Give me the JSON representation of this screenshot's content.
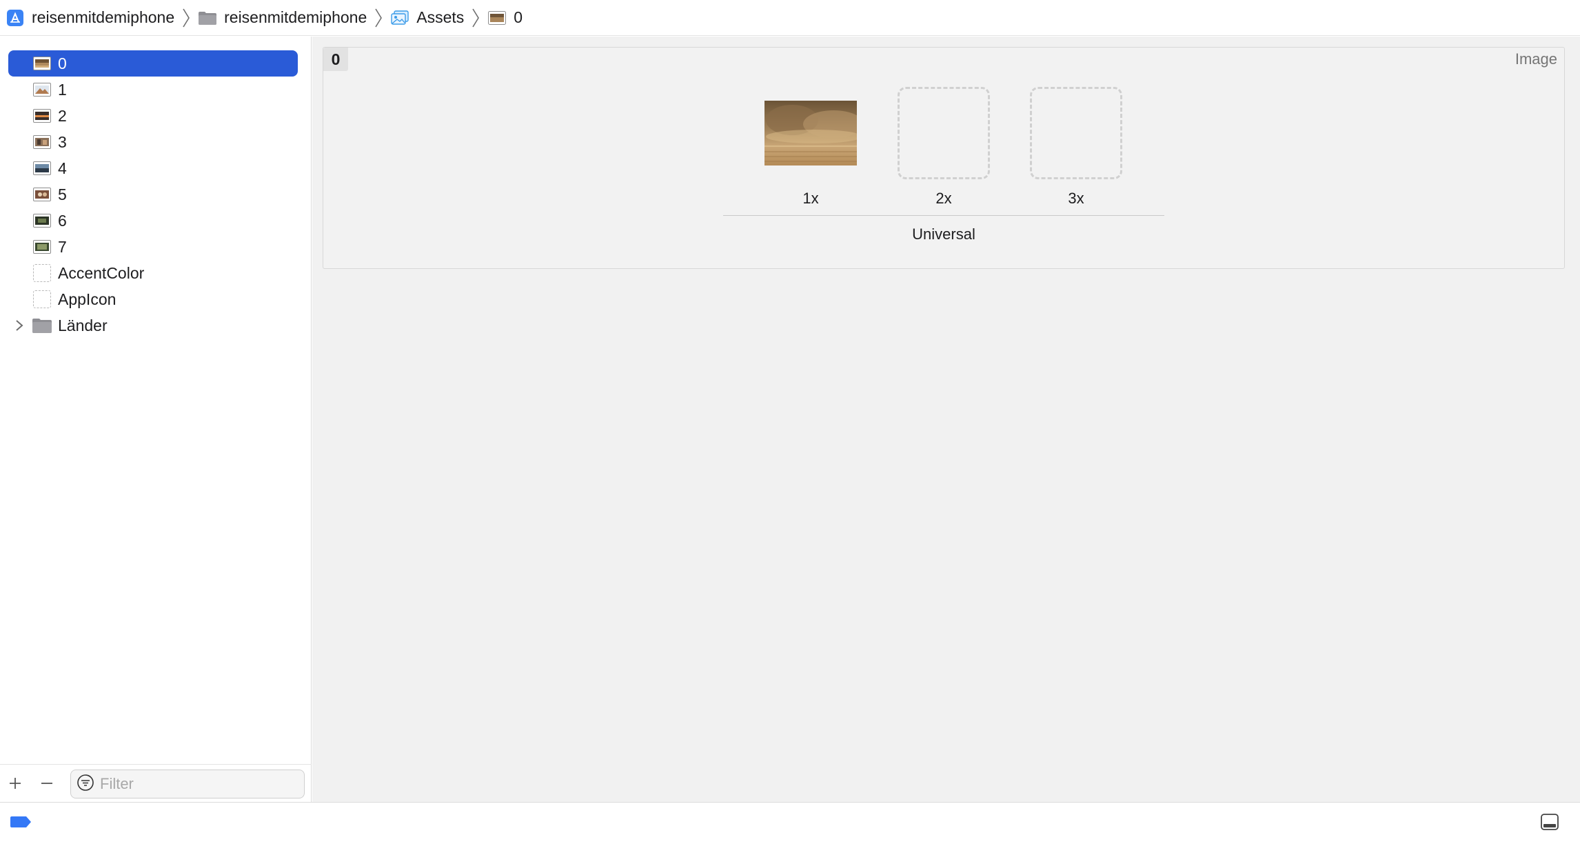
{
  "breadcrumb": {
    "items": [
      {
        "label": "reisenmitdemiphone",
        "icon": "xcode-project-icon"
      },
      {
        "label": "reisenmitdemiphone",
        "icon": "folder-icon"
      },
      {
        "label": "Assets",
        "icon": "asset-catalog-icon"
      },
      {
        "label": "0",
        "icon": "image-set-icon"
      }
    ]
  },
  "sidebar": {
    "items": [
      {
        "label": "0",
        "kind": "image",
        "selected": true
      },
      {
        "label": "1",
        "kind": "image"
      },
      {
        "label": "2",
        "kind": "image"
      },
      {
        "label": "3",
        "kind": "image"
      },
      {
        "label": "4",
        "kind": "image"
      },
      {
        "label": "5",
        "kind": "image"
      },
      {
        "label": "6",
        "kind": "image"
      },
      {
        "label": "7",
        "kind": "image"
      },
      {
        "label": "AccentColor",
        "kind": "placeholder"
      },
      {
        "label": "AppIcon",
        "kind": "placeholder"
      },
      {
        "label": "Länder",
        "kind": "folder"
      }
    ],
    "filter_placeholder": "Filter",
    "add_button": "+",
    "remove_button": "–"
  },
  "editor": {
    "asset_name": "0",
    "asset_type": "Image",
    "slots": [
      {
        "label": "1x",
        "filled": true
      },
      {
        "label": "2x",
        "filled": false
      },
      {
        "label": "3x",
        "filled": false
      }
    ],
    "device_group": "Universal"
  },
  "colors": {
    "selection": "#2a5bd7",
    "accent_blue": "#3478f6",
    "editor_bg": "#f1f1f1"
  }
}
